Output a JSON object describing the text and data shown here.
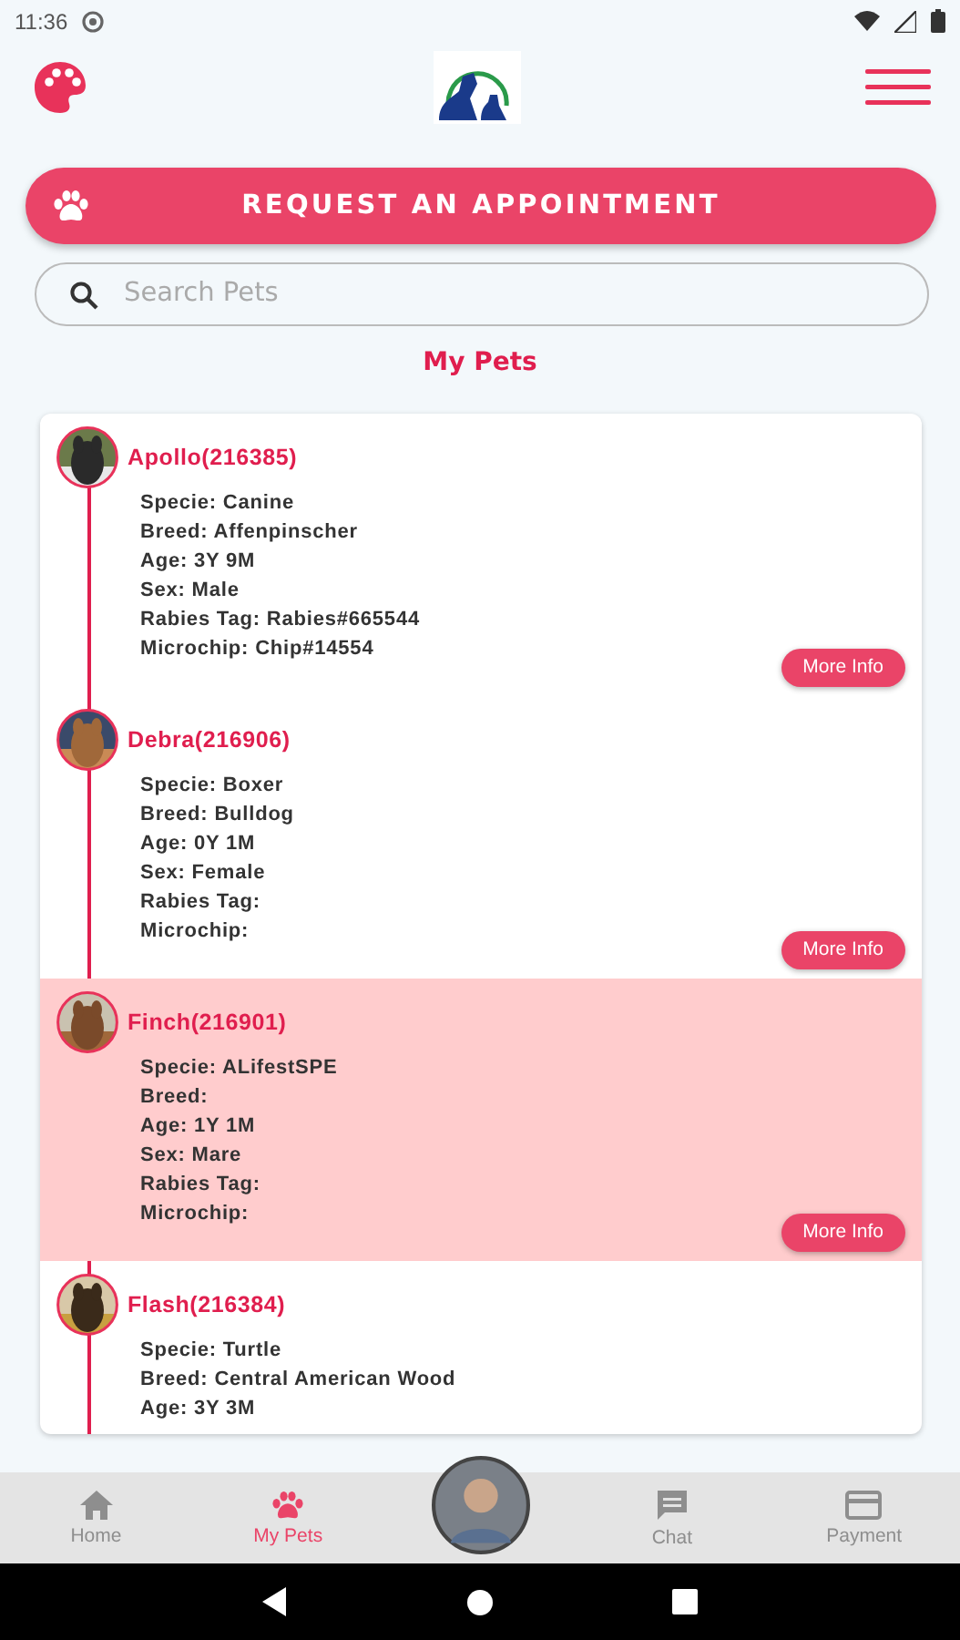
{
  "status_bar": {
    "time": "11:36"
  },
  "appointment_button": {
    "label": "REQUEST AN APPOINTMENT"
  },
  "search": {
    "placeholder": "Search Pets"
  },
  "section_title": "My Pets",
  "pets": [
    {
      "name": "Apollo(216385)",
      "selected": false,
      "details": [
        "Specie: Canine",
        "Breed: Affenpinscher",
        "Age: 3Y 9M",
        "Sex: Male",
        "Rabies Tag: Rabies#665544",
        "Microchip: Chip#14554"
      ],
      "button": "More Info"
    },
    {
      "name": "Debra(216906)",
      "selected": false,
      "details": [
        "Specie: Boxer",
        "Breed: Bulldog",
        "Age: 0Y 1M",
        "Sex: Female",
        "Rabies Tag:",
        "Microchip:"
      ],
      "button": "More Info"
    },
    {
      "name": "Finch(216901)",
      "selected": true,
      "details": [
        "Specie: ALifestSPE",
        "Breed:",
        "Age: 1Y 1M",
        "Sex: Mare",
        "Rabies Tag:",
        "Microchip:"
      ],
      "button": "More Info"
    },
    {
      "name": "Flash(216384)",
      "selected": false,
      "details": [
        "Specie: Turtle",
        "Breed: Central American Wood",
        "Age: 3Y 3M"
      ]
    }
  ],
  "bottom_nav": [
    {
      "label": "Home",
      "kind": "home",
      "selected": false
    },
    {
      "label": "My Pets",
      "kind": "paw",
      "selected": true
    },
    {
      "kind": "avatar"
    },
    {
      "label": "Chat",
      "kind": "chat",
      "selected": false
    },
    {
      "label": "Payment",
      "kind": "card",
      "selected": false
    }
  ]
}
